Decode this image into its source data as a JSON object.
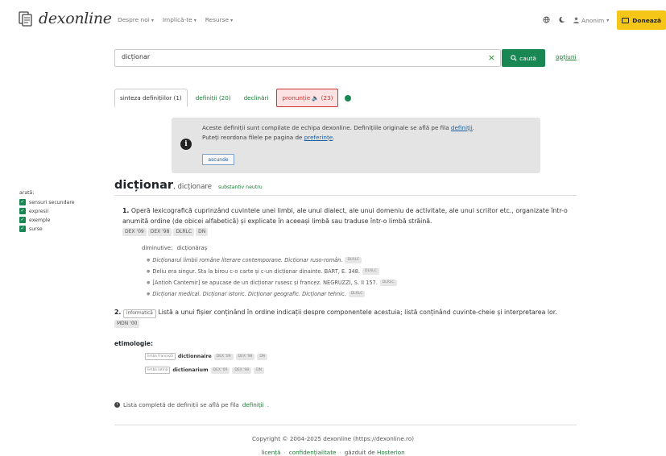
{
  "brand": {
    "logo_text": "dexonline"
  },
  "nav": {
    "items": [
      "Despre noi",
      "Implică-te",
      "Resurse"
    ],
    "user": "Anonim",
    "donate": "Donează"
  },
  "search": {
    "value": "dicționar",
    "button": "caută",
    "options": "opțiuni"
  },
  "tabs": {
    "synthesis": "sinteza definițiilor (1)",
    "definitions": "definiții (20)",
    "declension": "declinări",
    "pronunciation": "pronunție 🔈 (23)"
  },
  "info": {
    "line1_pre": "Aceste definiții sunt compilate de echipa dexonline. Definițiile originale se află pe fila ",
    "line1_link": "definiții",
    "line1_post": ".",
    "line2_pre": "Puteți reordona filele pe pagina de ",
    "line2_link": "preferințe",
    "line2_post": ".",
    "hide": "ascunde"
  },
  "sidebar": {
    "title": "arată:",
    "options": [
      "sensuri secundare",
      "expresii",
      "exemple",
      "surse"
    ]
  },
  "entry": {
    "headword": "dicționar",
    "variant": ", dicționare",
    "pos": "substantiv neutru",
    "def1_num": "1.",
    "def1_text": "Operă lexicografică cuprinzând cuvintele unei limbi, ale unui dialect, ale unui domeniu de activitate, ale unui scriitor etc., organizate într-o anumită ordine (de obicei alfabetică) și explicate în aceeași limbă sau traduse într-o limbă străină.",
    "def1_sources": [
      "DEX '09",
      "DEX '98",
      "DLRLC",
      "DN"
    ],
    "diminutive_label": "diminutive:",
    "diminutive": "dicționăraș",
    "examples": [
      {
        "text": "Dicționarul limbii române literare contemporane. Dicționar ruso-român.",
        "italic": true,
        "src": "DLRLC"
      },
      {
        "text": "Deliu era singur. Sta la birou c-o carte și c-un dicționar dinainte. BART, E. 348.",
        "italic": false,
        "src": "DLRLC"
      },
      {
        "text": "[Antioh Cantemir] se apucase de un dicționar rusesc și francez. NEGRUZZI, S. II 157.",
        "italic": false,
        "src": "DLRLC"
      },
      {
        "text": "Dicționar medical. Dicționar istoric. Dicționar geografic. Dicționar tehnic.",
        "italic": true,
        "src": "DLRLC"
      }
    ],
    "def2_num": "2.",
    "def2_domain": "informatică",
    "def2_text": "Listă a unui fișier conținând în ordine indicații despre componentele acestuia; listă conținând cuvinte-cheie și interpretarea lor.",
    "def2_source": "MDN '00",
    "etym_title": "etimologie:",
    "etymology": [
      {
        "lang": "limba franceză",
        "word": "dictionnaire",
        "sources": [
          "DEX '09",
          "DEX '98",
          "DN"
        ]
      },
      {
        "lang": "limba latină",
        "word": "dictionarium",
        "sources": [
          "DEX '09",
          "DEX '98",
          "DN"
        ]
      }
    ]
  },
  "complete": {
    "pre": "Lista completă de definiții se află pe fila ",
    "link": "definiții",
    "post": "."
  },
  "footer": {
    "copyright": "Copyright © 2004-2025 dexonline (https://dexonline.ro)",
    "links": [
      "licență",
      "confidențialitate"
    ],
    "hosted_pre": "găzduit de ",
    "hosted_link": "Hosterion"
  },
  "colors": {
    "accent": "#198754",
    "donate": "#f5c518",
    "pron_bg": "#fbe3e3",
    "pron_border": "#cc3333"
  }
}
